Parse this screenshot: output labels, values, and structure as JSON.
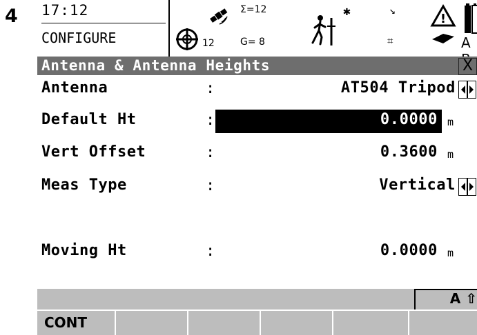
{
  "step_number": "4",
  "status": {
    "time": "17:12",
    "mode": "CONFIGURE",
    "satellites_tracked": "12",
    "sigma_text": "Σ=12",
    "g_text": "G= 8",
    "ab_label": "A B"
  },
  "title_bar": {
    "title": "Antenna & Antenna Heights",
    "close_label": "X"
  },
  "fields": {
    "antenna": {
      "label": "Antenna",
      "colon": ":",
      "value": "AT504 Tripod"
    },
    "default_ht": {
      "label": "Default Ht",
      "colon": ":",
      "value": "0.0000",
      "unit": "m"
    },
    "vert_offset": {
      "label": "Vert Offset",
      "colon": ":",
      "value": "0.3600",
      "unit": "m"
    },
    "meas_type": {
      "label": "Meas Type",
      "colon": ":",
      "value": "Vertical"
    },
    "moving_ht": {
      "label": "Moving Ht",
      "colon": ":",
      "value": "0.0000",
      "unit": "m"
    }
  },
  "info_strip": {
    "caps_indicator": "A ⇧"
  },
  "softkeys": [
    {
      "label": "CONT"
    },
    {
      "label": ""
    },
    {
      "label": ""
    },
    {
      "label": ""
    },
    {
      "label": ""
    },
    {
      "label": ""
    }
  ]
}
